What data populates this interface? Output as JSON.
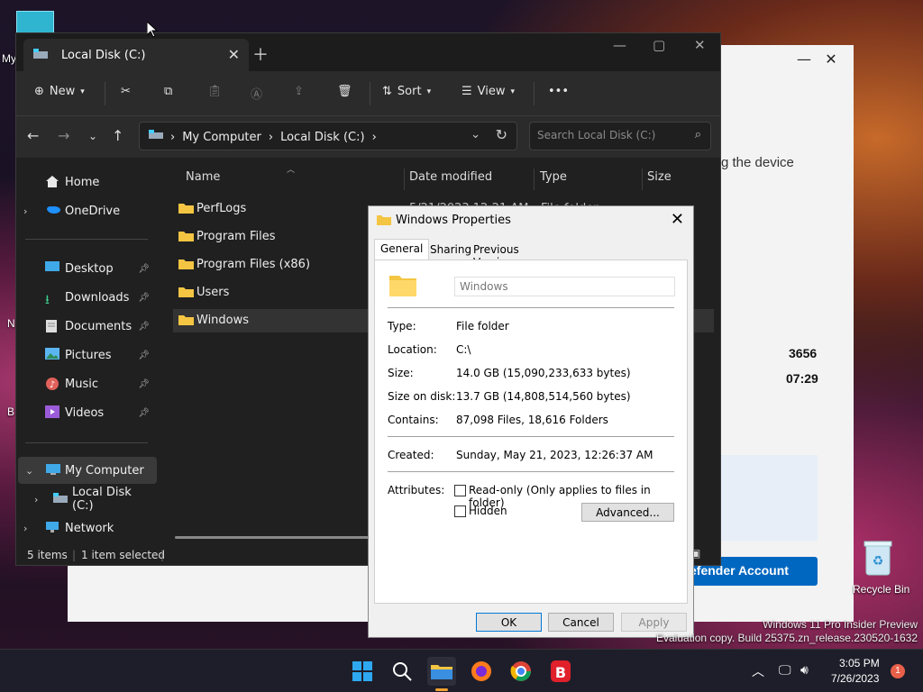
{
  "desktop": {
    "label_my": "My",
    "label_n": "N",
    "label_b": "B",
    "recycle_bin": "Recycle Bin",
    "watermark_line1": "Windows 11 Pro Insider Preview",
    "watermark_line2": "Evaluation copy. Build 25375.zn_release.230520-1632"
  },
  "background_window": {
    "text_device": "g the device",
    "num1": "3656",
    "num2": "07:29",
    "button": "efender Account"
  },
  "explorer": {
    "tab_title": "Local Disk (C:)",
    "toolbar": {
      "new": "New",
      "sort": "Sort",
      "view": "View",
      "more": "•••"
    },
    "breadcrumb": [
      "My Computer",
      "Local Disk (C:)"
    ],
    "search_placeholder": "Search Local Disk (C:)",
    "sidebar": {
      "home": "Home",
      "onedrive": "OneDrive",
      "desktop": "Desktop",
      "downloads": "Downloads",
      "documents": "Documents",
      "pictures": "Pictures",
      "music": "Music",
      "videos": "Videos",
      "my_computer": "My Computer",
      "local_disk": "Local Disk (C:)",
      "network": "Network"
    },
    "columns": {
      "name": "Name",
      "date": "Date modified",
      "type": "Type",
      "size": "Size"
    },
    "first_row_date": "5/21/2023 12:21 AM",
    "first_row_type": "File folder",
    "files": [
      "PerfLogs",
      "Program Files",
      "Program Files (x86)",
      "Users",
      "Windows"
    ],
    "status_items": "5 items",
    "status_selected": "1 item selected"
  },
  "dialog": {
    "title": "Windows Properties",
    "tabs": [
      "General",
      "Sharing",
      "Previous Versions"
    ],
    "name_value": "Windows",
    "type_label": "Type:",
    "type_value": "File folder",
    "location_label": "Location:",
    "location_value": "C:\\",
    "size_label": "Size:",
    "size_value": "14.0 GB (15,090,233,633 bytes)",
    "size_on_disk_label": "Size on disk:",
    "size_on_disk_value": "13.7 GB (14,808,514,560 bytes)",
    "contains_label": "Contains:",
    "contains_value": "87,098 Files, 18,616 Folders",
    "created_label": "Created:",
    "created_value": "Sunday, May 21, 2023, 12:26:37 AM",
    "attributes_label": "Attributes:",
    "readonly_label": "Read-only (Only applies to files in folder)",
    "hidden_label": "Hidden",
    "advanced_button": "Advanced...",
    "ok_button": "OK",
    "cancel_button": "Cancel",
    "apply_button": "Apply"
  },
  "taskbar": {
    "time": "3:05 PM",
    "date": "7/26/2023",
    "notification_count": "1"
  },
  "colors": {
    "accent": "#0067c0",
    "folder": "#f4c542",
    "explorer_bg": "#202020"
  }
}
